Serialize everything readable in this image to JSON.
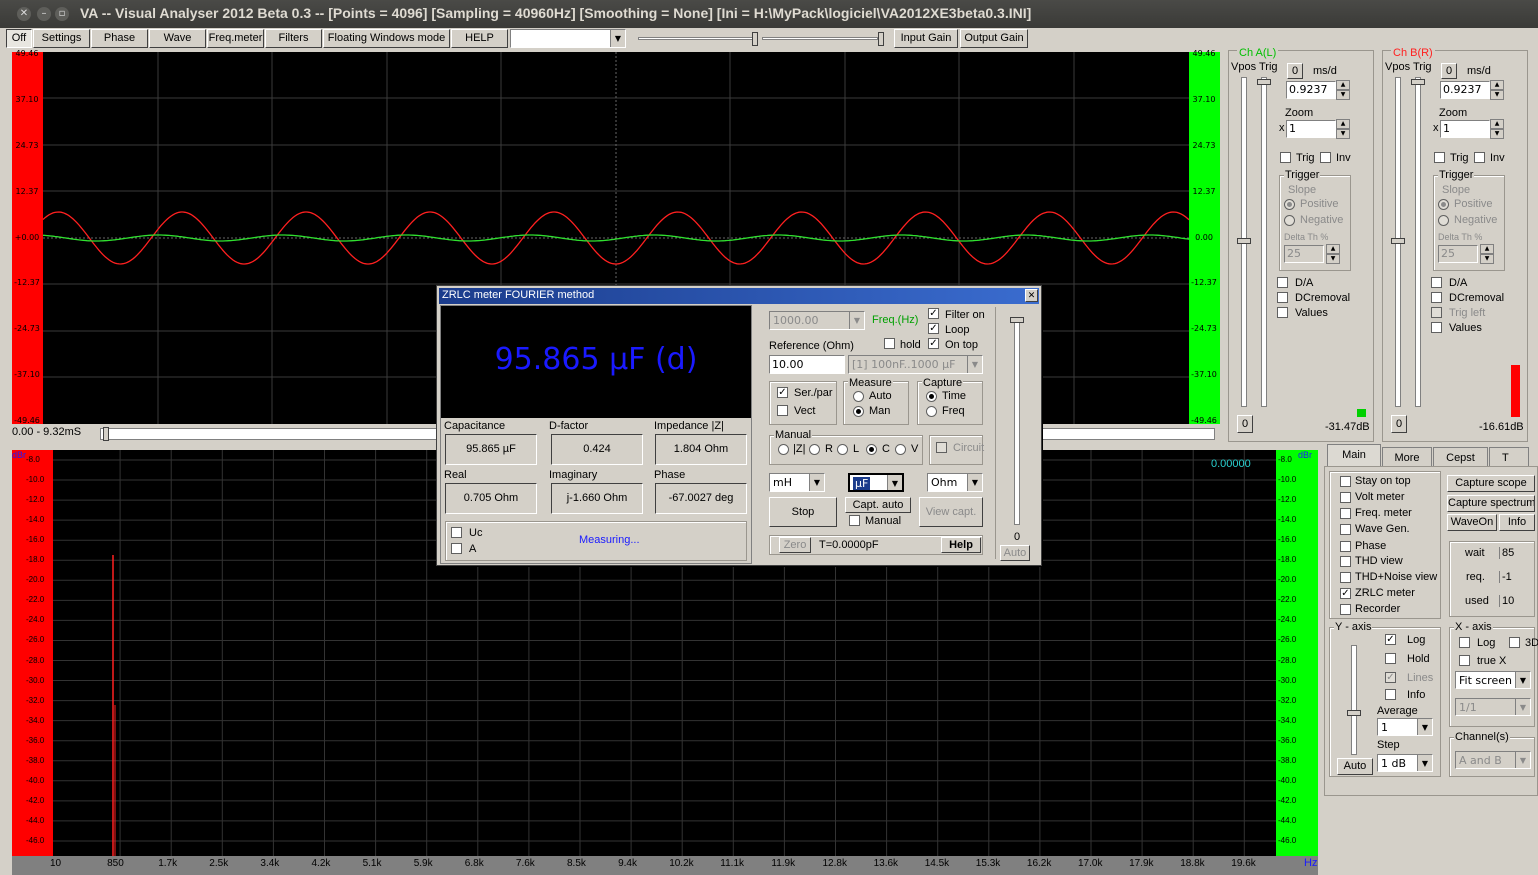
{
  "window": {
    "title": "VA -- Visual Analyser 2012 Beta 0.3 --  [Points = 4096]  [Sampling = 40960Hz]  [Smoothing = None]  [Ini = H:\\MyPack\\logiciel\\VA2012XE3beta0.3.INI]"
  },
  "toolbar": {
    "buttons": [
      "Off",
      "Settings",
      "Phase",
      "Wave",
      "Freq.meter",
      "Filters",
      "Floating Windows mode",
      "HELP"
    ],
    "input_gain": "Input Gain",
    "output_gain": "Output Gain"
  },
  "scope": {
    "left_scale": [
      "49.46",
      "37.10",
      "24.73",
      "12.37",
      "+0.00",
      "-12.37",
      "-24.73",
      "-37.10",
      "-49.46"
    ],
    "right_scale": [
      "49.46",
      "37.10",
      "24.73",
      "12.37",
      "0.00",
      "-12.37",
      "-24.73",
      "-37.10",
      "-49.46"
    ],
    "time_range": "0.00 - 9.32mS"
  },
  "spectrum": {
    "unit_left": "dBr",
    "unit_right": "dBr",
    "readout": "0.00000",
    "y_ticks": [
      "-8.0",
      "-10.0",
      "-12.0",
      "-14.0",
      "-16.0",
      "-18.0",
      "-20.0",
      "-22.0",
      "-24.0",
      "-26.0",
      "-28.0",
      "-30.0",
      "-32.0",
      "-34.0",
      "-36.0",
      "-38.0",
      "-40.0",
      "-42.0",
      "-44.0",
      "-46.0"
    ],
    "x_ticks": [
      "10",
      "850",
      "1.7k",
      "2.5k",
      "3.4k",
      "4.2k",
      "5.1k",
      "5.9k",
      "6.8k",
      "7.6k",
      "8.5k",
      "9.4k",
      "10.2k",
      "11.1k",
      "11.9k",
      "12.8k",
      "13.6k",
      "14.5k",
      "15.3k",
      "16.2k",
      "17.0k",
      "17.9k",
      "18.8k",
      "19.6k"
    ],
    "x_unit": "Hz"
  },
  "channel_a": {
    "title": "Ch A(L)",
    "vpos": "Vpos",
    "trig": "Trig",
    "zero": "0",
    "ms_div": "ms/d",
    "ms_value": "0.9237",
    "zoom": "Zoom",
    "zoom_x": "x",
    "zoom_value": "1",
    "trig_chk": "Trig",
    "inv_chk": "Inv",
    "trigger": "Trigger",
    "slope": "Slope",
    "positive": "Positive",
    "negative": "Negative",
    "delta": "Delta Th %",
    "delta_value": "25",
    "da": "D/A",
    "dcremoval": "DCremoval",
    "values": "Values",
    "bottom_zero": "0",
    "level": "-31.47dB"
  },
  "channel_b": {
    "title": "Ch B(R)",
    "vpos": "Vpos",
    "trig": "Trig",
    "zero": "0",
    "ms_div": "ms/d",
    "ms_value": "0.9237",
    "zoom": "Zoom",
    "zoom_x": "x",
    "zoom_value": "1",
    "trig_chk": "Trig",
    "inv_chk": "Inv",
    "trigger": "Trigger",
    "slope": "Slope",
    "positive": "Positive",
    "negative": "Negative",
    "delta": "Delta Th %",
    "delta_value": "25",
    "da": "D/A",
    "dcremoval": "DCremoval",
    "trig_left": "Trig left",
    "values": "Values",
    "bottom_zero": "0",
    "level": "-16.61dB"
  },
  "tabs": [
    "Main",
    "More",
    "Cepst",
    "T"
  ],
  "main_panel": {
    "checks": [
      "Stay on top",
      "Volt meter",
      "Freq. meter",
      "Wave Gen.",
      "Phase",
      "THD view",
      "THD+Noise view",
      "ZRLC meter",
      "Recorder"
    ],
    "buttons": [
      "Capture scope",
      "Capture spectrum",
      "WaveOn",
      "Info"
    ],
    "wait": "wait",
    "wait_value": "85",
    "req": "req.",
    "req_value": "-1",
    "used": "used",
    "used_value": "10",
    "y_axis": "Y - axis",
    "log": "Log",
    "hold": "Hold",
    "lines": "Lines",
    "info": "Info",
    "average": "Average",
    "average_value": "1",
    "step": "Step",
    "step_value": "1 dB",
    "auto": "Auto",
    "x_axis": "X - axis",
    "xlog": "Log",
    "x3d": "3D",
    "truex": "true X",
    "fit": "Fit screen",
    "ratio": "1/1",
    "channels": "Channel(s)",
    "channels_value": "A and B"
  },
  "zrlc": {
    "title": "ZRLC meter FOURIER method",
    "reading": "95.865 µF (d)",
    "capacitance_label": "Capacitance",
    "capacitance": "95.865 µF",
    "dfactor_label": "D-factor",
    "dfactor": "0.424",
    "impedance_label": "Impedance |Z|",
    "impedance": "1.804 Ohm",
    "real_label": "Real",
    "real": "0.705 Ohm",
    "imag_label": "Imaginary",
    "imag": "j-1.660 Ohm",
    "phase_label": "Phase",
    "phase": "-67.0027 deg",
    "uc": "Uc",
    "a": "A",
    "status": "Measuring...",
    "freq_value": "1000.00",
    "freq_label": "Freq.(Hz)",
    "filter_on": "Filter on",
    "loop": "Loop",
    "on_top": "On top",
    "hold": "hold",
    "reference_label": "Reference (Ohm)",
    "reference": "10.00",
    "range": "[1] 100nF..1000 µF",
    "serpar": "Ser./par",
    "vect": "Vect",
    "measure": "Measure",
    "m_auto": "Auto",
    "m_man": "Man",
    "capture": "Capture",
    "c_time": "Time",
    "c_freq": "Freq",
    "manual": "Manual",
    "m_z": "|Z|",
    "m_r": "R",
    "m_l": "L",
    "m_c": "C",
    "m_v": "V",
    "circuit": "Circuit",
    "unit_l": "mH",
    "unit_c": "µF",
    "unit_r": "Ohm",
    "stop": "Stop",
    "capt_auto": "Capt. auto",
    "capt_manual": "Manual",
    "view_capt": "View capt.",
    "zero": "Zero",
    "t_value": "T=0.0000pF",
    "help": "Help",
    "slider_zero": "0",
    "slider_auto": "Auto"
  }
}
